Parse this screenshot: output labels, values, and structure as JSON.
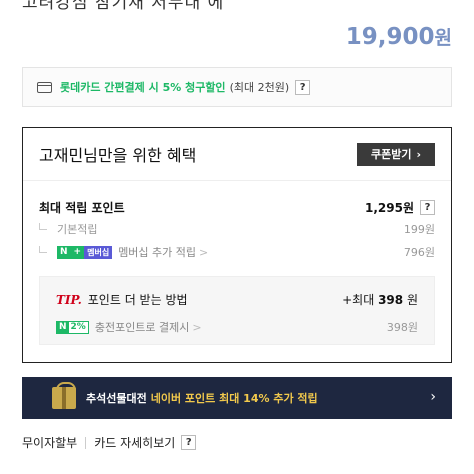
{
  "product": {
    "title_partial": "고려강심 참기재 저두대 에",
    "price_value": "19,900",
    "price_unit": "원"
  },
  "card_promo": {
    "icon": "credit-card-icon",
    "main_text": "롯데카드 간편결제 시 5% 청구할인",
    "sub_text": "(최대 2천원)",
    "help_label": "?"
  },
  "benefit": {
    "title": "고재민님만을 위한 혜택",
    "coupon_button": "쿠폰받기",
    "coupon_chevron": "›",
    "max_points": {
      "label": "최대 적립 포인트",
      "value": "1,295원",
      "help_label": "?"
    },
    "basic": {
      "label": "기본적립",
      "value": "199원"
    },
    "membership": {
      "badge_n": "N",
      "badge_plus": "+",
      "badge_text": "멤버십",
      "label": "멤버십 추가 적립",
      "chevron": ">",
      "value": "796원"
    },
    "tip": {
      "tag": "TIP.",
      "text": "포인트 더 받는 방법",
      "value_prefix": "+최대",
      "value_amount": "398",
      "value_unit": "원",
      "charge_badge_n": "N",
      "charge_badge_pct": "2%",
      "charge_label": "충전포인트로 결제시",
      "charge_chevron": ">",
      "charge_value": "398원"
    }
  },
  "banner": {
    "icon": "gift-box-icon",
    "left_text": "추석선물대전",
    "right_text": "네이버 포인트 최대 14% 추가 적립",
    "chevron": "›"
  },
  "bottom_links": {
    "installment": "무이자할부",
    "card_detail": "카드 자세히보기",
    "help_label": "?"
  },
  "colors": {
    "price": "#7891c2",
    "green": "#1db866",
    "banner_bg": "#1e2740",
    "banner_highlight": "#f2c94c",
    "tip_red": "#d0021b"
  }
}
